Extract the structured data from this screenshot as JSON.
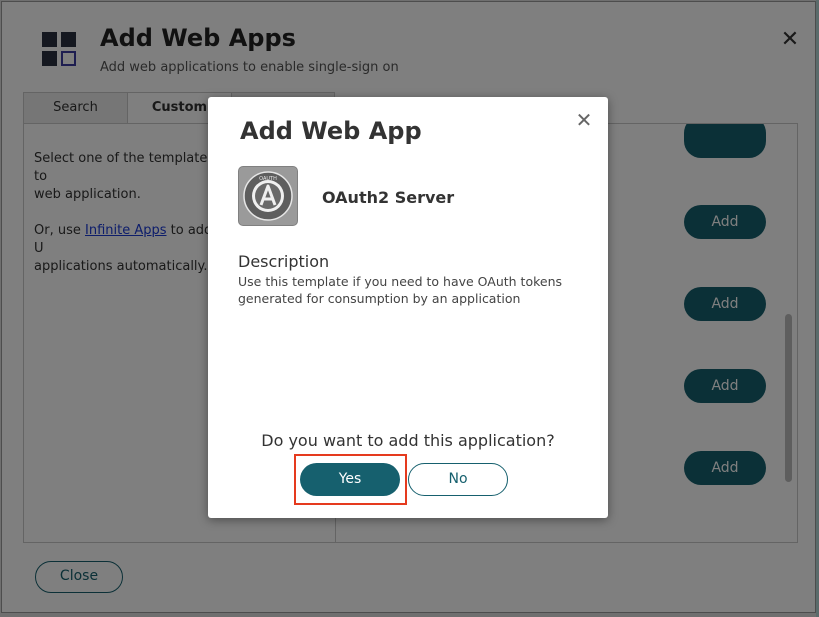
{
  "dialog": {
    "title": "Add Web Apps",
    "subtitle": "Add web applications to enable single-sign on",
    "close_label": "Close"
  },
  "tabs": [
    {
      "label": "Search"
    },
    {
      "label": "Custom"
    },
    {
      "label": ""
    }
  ],
  "left_panel": {
    "line1": "Select one of the templates to",
    "line2": "web application.",
    "or_prefix": "Or, use",
    "link_text": "Infinite Apps",
    "line3_suffix": "to add U",
    "line4": "applications automatically."
  },
  "right_panel": {
    "add_buttons": [
      "Add",
      "Add",
      "Add",
      "Add"
    ]
  },
  "modal": {
    "title": "Add Web App",
    "app_name": "OAuth2 Server",
    "app_icon_text": "OAUTH",
    "description_label": "Description",
    "description_text": "Use this template if you need to have OAuth tokens generated for consumption by an application",
    "question": "Do you want to add this application?",
    "yes_label": "Yes",
    "no_label": "No"
  },
  "colors": {
    "accent": "#16606e",
    "highlight": "#e53a1e"
  }
}
